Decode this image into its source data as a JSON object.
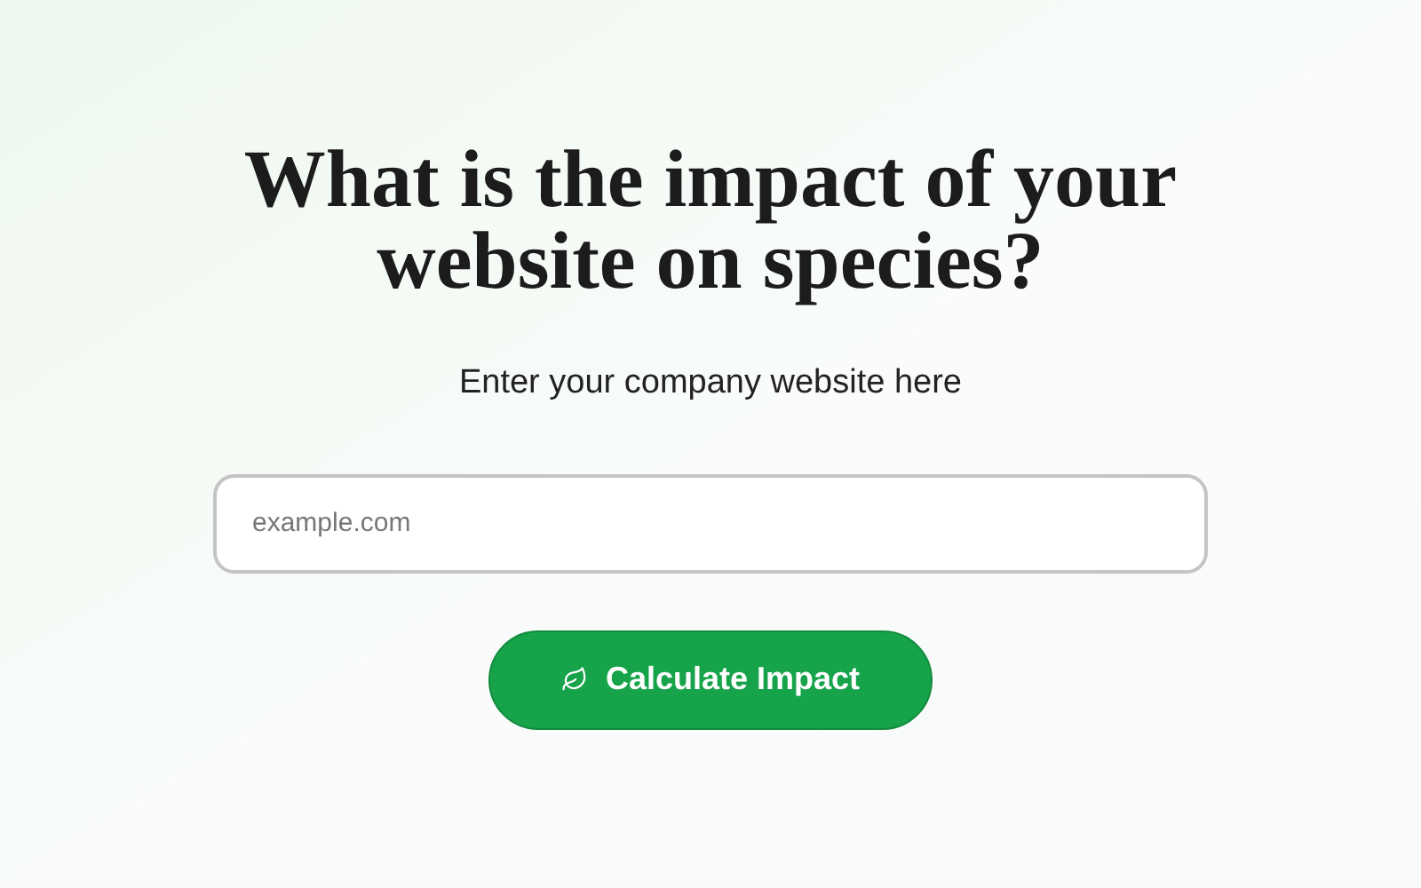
{
  "heading": "What is the impact of your website on species?",
  "subheading": "Enter your company website here",
  "website_field": {
    "placeholder": "example.com"
  },
  "button": {
    "label": "Calculate Impact"
  }
}
